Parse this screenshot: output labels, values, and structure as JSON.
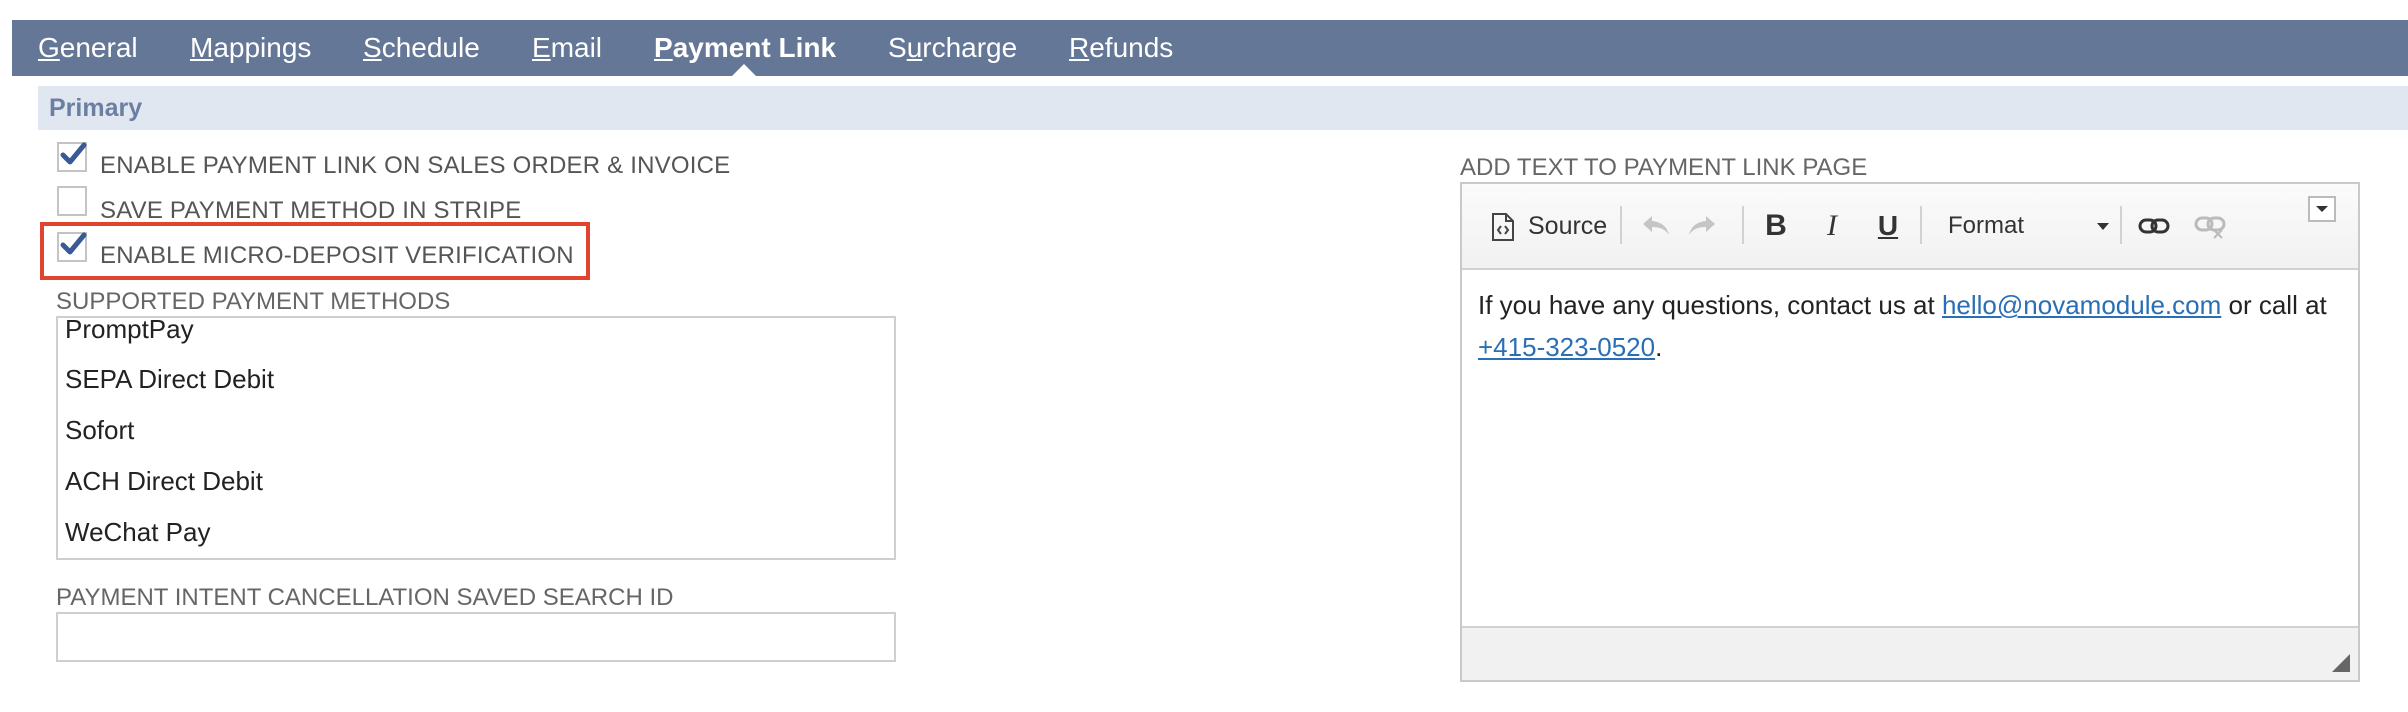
{
  "tabs": [
    {
      "accel": "G",
      "rest": "eneral",
      "active": false
    },
    {
      "accel": "M",
      "rest": "appings",
      "active": false
    },
    {
      "accel": "S",
      "rest": "chedule",
      "active": false
    },
    {
      "accel": "E",
      "rest": "mail",
      "active": false
    },
    {
      "accel": "P",
      "rest": "ayment Link",
      "active": true
    },
    {
      "pre": "S",
      "accel": "u",
      "rest": "rcharge",
      "active": false
    },
    {
      "accel": "R",
      "rest": "efunds",
      "active": false
    }
  ],
  "section": {
    "title": "Primary"
  },
  "checkboxes": [
    {
      "label": "ENABLE PAYMENT LINK ON SALES ORDER & INVOICE",
      "checked": true
    },
    {
      "label": "SAVE PAYMENT METHOD IN STRIPE",
      "checked": false
    },
    {
      "label": "ENABLE MICRO-DEPOSIT VERIFICATION",
      "checked": true
    }
  ],
  "payment_methods": {
    "label": "SUPPORTED PAYMENT METHODS",
    "items": [
      "PromptPay",
      "SEPA Direct Debit",
      "Sofort",
      "ACH Direct Debit",
      "WeChat Pay"
    ]
  },
  "cancellation_search": {
    "label": "PAYMENT INTENT CANCELLATION SAVED SEARCH ID",
    "value": ""
  },
  "editor": {
    "label": "ADD TEXT TO PAYMENT LINK PAGE",
    "toolbar": {
      "source_label": "Source",
      "format_label": "Format",
      "icons": [
        "source-icon",
        "undo-icon",
        "redo-icon",
        "bold-icon",
        "italic-icon",
        "underline-icon",
        "format-dropdown",
        "link-icon",
        "unlink-icon",
        "toolbar-collapse-icon"
      ]
    },
    "content": {
      "text_before": "If you have any questions, contact us at ",
      "email_link": "hello@novamodule.com",
      "text_middle": " or call at ",
      "phone_link": "+415-323-0520",
      "text_after": "."
    }
  },
  "colors": {
    "tabbar": "#657796",
    "section_bar": "#e1e7f0",
    "section_title": "#6b7fa3",
    "checkmark": "#3a5a97",
    "highlight": "#e0442e",
    "link": "#2a6fb5"
  }
}
